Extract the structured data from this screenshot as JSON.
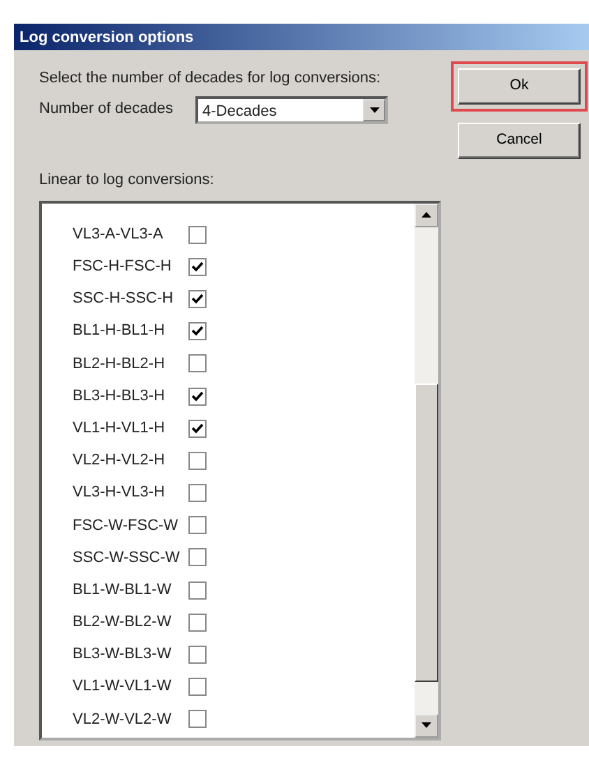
{
  "window": {
    "title": "Log conversion options"
  },
  "decades_prompt": "Select the number of decades for log conversions:",
  "decades_field": {
    "label": "Number of decades",
    "value": "4-Decades"
  },
  "buttons": [
    {
      "label": "Ok",
      "highlighted": true
    },
    {
      "label": "Cancel",
      "highlighted": false
    }
  ],
  "conversions_label": "Linear to log conversions:",
  "conversions": [
    {
      "name": "VL3-A-VL3-A",
      "checked": false
    },
    {
      "name": "FSC-H-FSC-H",
      "checked": true
    },
    {
      "name": "SSC-H-SSC-H",
      "checked": true
    },
    {
      "name": "BL1-H-BL1-H",
      "checked": true
    },
    {
      "name": "BL2-H-BL2-H",
      "checked": false
    },
    {
      "name": "BL3-H-BL3-H",
      "checked": true
    },
    {
      "name": "VL1-H-VL1-H",
      "checked": true
    },
    {
      "name": "VL2-H-VL2-H",
      "checked": false
    },
    {
      "name": "VL3-H-VL3-H",
      "checked": false
    },
    {
      "name": "FSC-W-FSC-W",
      "checked": false
    },
    {
      "name": "SSC-W-SSC-W",
      "checked": false
    },
    {
      "name": "BL1-W-BL1-W",
      "checked": false
    },
    {
      "name": "BL2-W-BL2-W",
      "checked": false
    },
    {
      "name": "BL3-W-BL3-W",
      "checked": false
    },
    {
      "name": "VL1-W-VL1-W",
      "checked": false
    },
    {
      "name": "VL2-W-VL2-W",
      "checked": false
    }
  ]
}
